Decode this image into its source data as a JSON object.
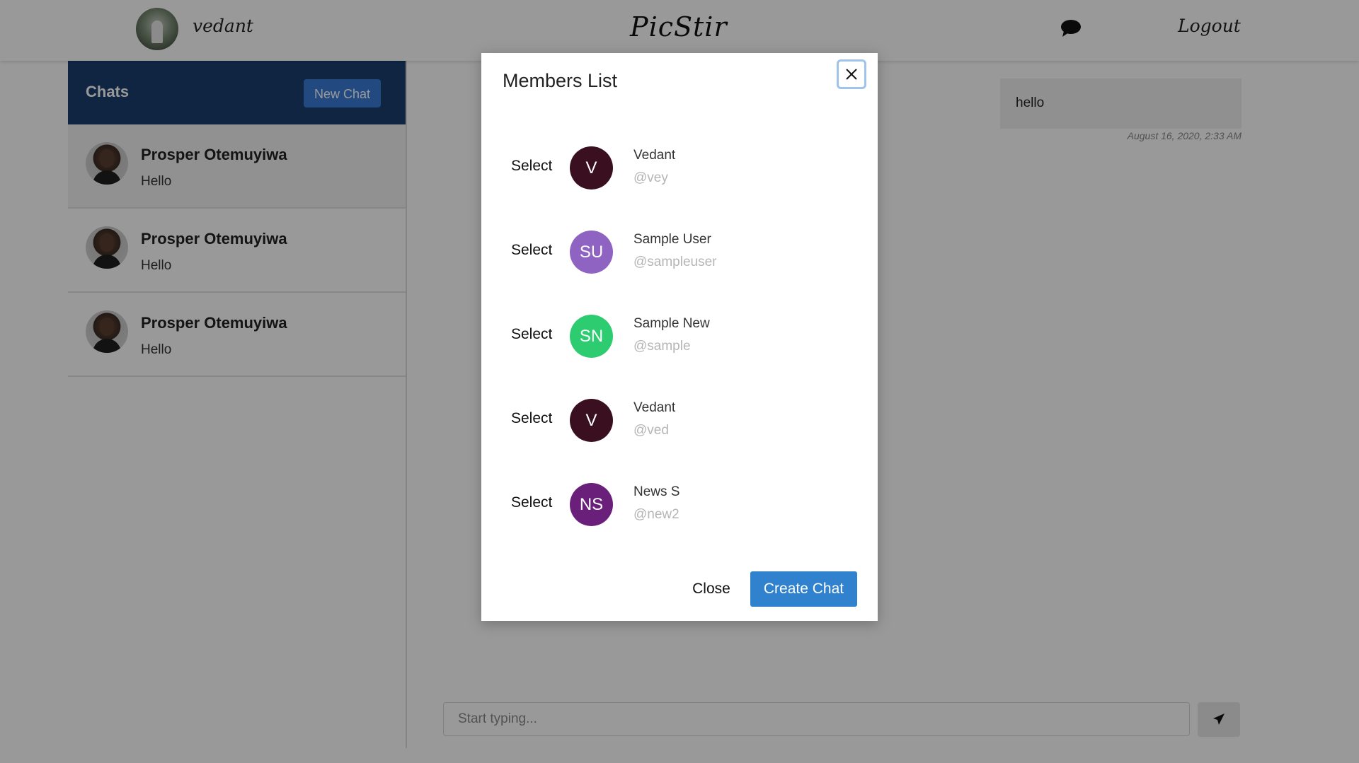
{
  "navbar": {
    "username": "vedant",
    "brand": "PicStir",
    "logout_label": "Logout"
  },
  "sidebar": {
    "title": "Chats",
    "new_chat_label": "New Chat",
    "chats": [
      {
        "name": "Prosper Otemuyiwa",
        "preview": "Hello"
      },
      {
        "name": "Prosper Otemuyiwa",
        "preview": "Hello"
      },
      {
        "name": "Prosper Otemuyiwa",
        "preview": "Hello"
      }
    ]
  },
  "conversation": {
    "message_text": "hello",
    "message_time": "August 16, 2020, 2:33 AM",
    "composer_placeholder": "Start typing..."
  },
  "modal": {
    "title": "Members List",
    "select_label": "Select",
    "members": [
      {
        "initials": "V",
        "name": "Vedant",
        "handle": "@vey",
        "color": "#3a0f1f"
      },
      {
        "initials": "SU",
        "name": "Sample User",
        "handle": "@sampleuser",
        "color": "#8e63c2"
      },
      {
        "initials": "SN",
        "name": "Sample New",
        "handle": "@sample",
        "color": "#2ecc71"
      },
      {
        "initials": "V",
        "name": "Vedant",
        "handle": "@ved",
        "color": "#3a0f1f"
      },
      {
        "initials": "NS",
        "name": "News S",
        "handle": "@new2",
        "color": "#6a1f7a"
      }
    ],
    "close_label": "Close",
    "create_label": "Create Chat"
  },
  "colors": {
    "sidebar_header": "#1a3f6f",
    "new_chat_button": "#3a7bd5",
    "create_chat_button": "#3182ce",
    "backdrop": "rgba(0,0,0,0.4)"
  },
  "icons": {
    "nav_chat": "speech-bubble-icon",
    "send": "paper-plane-icon",
    "modal_close": "close-icon"
  }
}
